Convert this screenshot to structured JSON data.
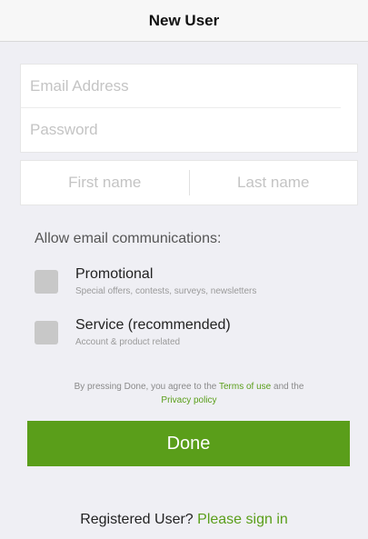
{
  "navbar": {
    "title": "New User"
  },
  "credentials": {
    "email_placeholder": "Email Address",
    "password_placeholder": "Password"
  },
  "names": {
    "first_placeholder": "First name",
    "last_placeholder": "Last name"
  },
  "communications": {
    "heading": "Allow email communications:",
    "options": [
      {
        "label": "Promotional",
        "description": "Special offers, contests, surveys, newsletters",
        "checked": false
      },
      {
        "label": "Service (recommended)",
        "description": "Account & product related",
        "checked": false
      }
    ]
  },
  "terms": {
    "prefix": "By pressing Done, you agree to the",
    "terms_link": "Terms of use",
    "middle": "and the",
    "privacy_link": "Privacy policy"
  },
  "done_label": "Done",
  "footer": {
    "question": "Registered User?",
    "signin_link": "Please sign in"
  },
  "colors": {
    "accent": "#5a9e1a",
    "background": "#efeff4",
    "checkbox": "#c8c8c8"
  }
}
